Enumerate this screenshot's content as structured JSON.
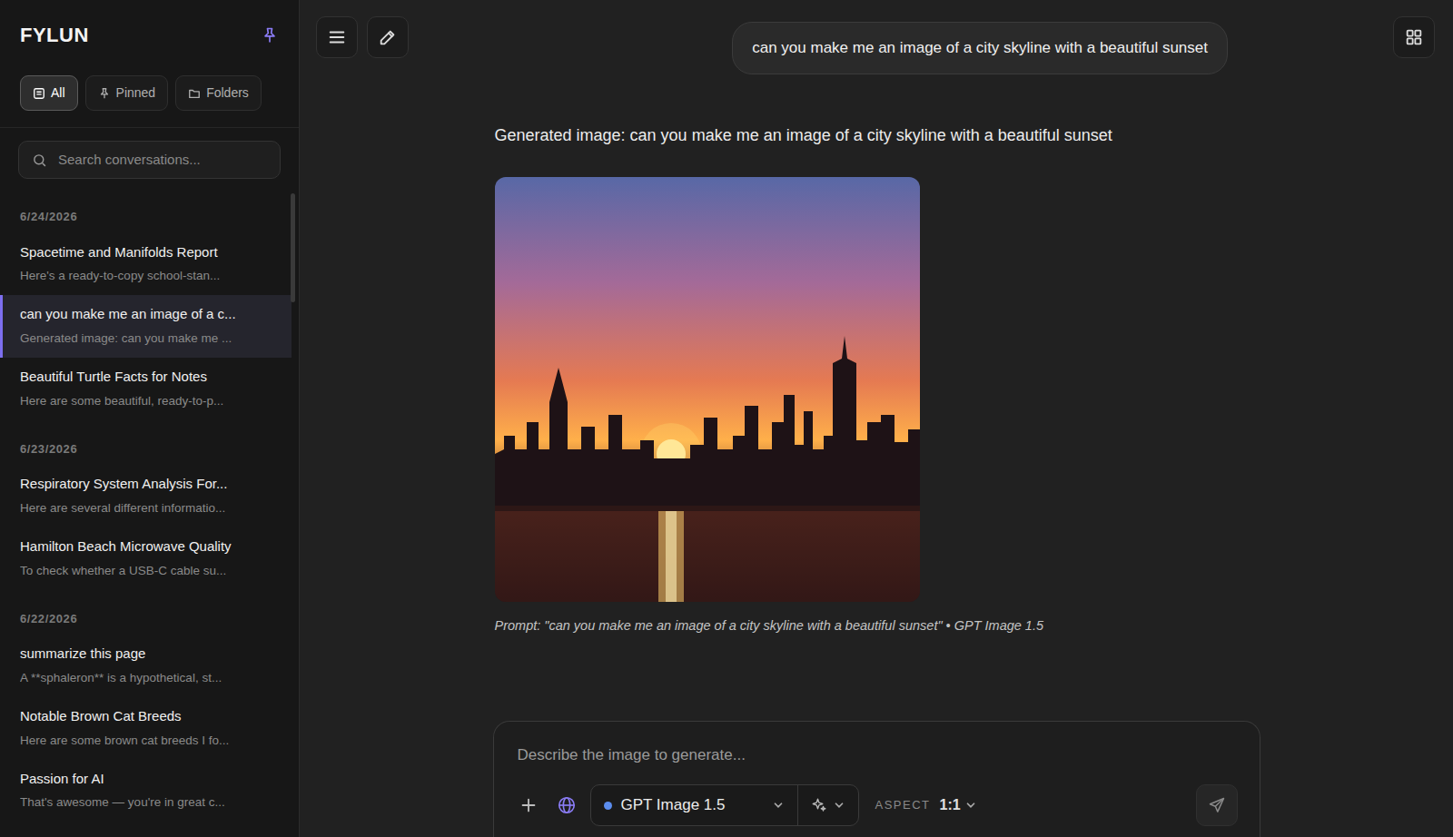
{
  "app": {
    "logo": "FYLUN"
  },
  "filters": [
    {
      "label": "All",
      "selected": true
    },
    {
      "label": "Pinned",
      "selected": false
    },
    {
      "label": "Folders",
      "selected": false
    }
  ],
  "search": {
    "placeholder": "Search conversations..."
  },
  "groups": [
    {
      "date": "6/24/2026",
      "items": [
        {
          "title": "Spacetime and Manifolds Report",
          "preview": "Here's a ready-to-copy school-stan...",
          "selected": false
        },
        {
          "title": "can you make me an image of a c...",
          "preview": "Generated image: can you make me ...",
          "selected": true
        },
        {
          "title": "Beautiful Turtle Facts for Notes",
          "preview": "Here are some beautiful, ready-to-p...",
          "selected": false
        }
      ]
    },
    {
      "date": "6/23/2026",
      "items": [
        {
          "title": "Respiratory System Analysis For...",
          "preview": "Here are several different informatio...",
          "selected": false
        },
        {
          "title": "Hamilton Beach Microwave Quality",
          "preview": "To check whether a USB-C cable su...",
          "selected": false
        }
      ]
    },
    {
      "date": "6/22/2026",
      "items": [
        {
          "title": "summarize this page",
          "preview": "A **sphaleron** is a hypothetical, st...",
          "selected": false
        },
        {
          "title": "Notable Brown Cat Breeds",
          "preview": "Here are some brown cat breeds I fo...",
          "selected": false
        },
        {
          "title": "Passion for AI",
          "preview": "That's awesome — you're in great c...",
          "selected": false
        }
      ]
    }
  ],
  "chat": {
    "user_message": "can you make me an image of a city skyline with a beautiful sunset",
    "reply_text": "Generated image: can you make me an image of a city skyline with a beautiful sunset",
    "caption": "Prompt: \"can you make me an image of a city skyline with a beautiful sunset\" • GPT Image 1.5"
  },
  "composer": {
    "placeholder": "Describe the image to generate...",
    "model": "GPT Image 1.5",
    "aspect_label": "ASPECT",
    "aspect": "1:1"
  }
}
